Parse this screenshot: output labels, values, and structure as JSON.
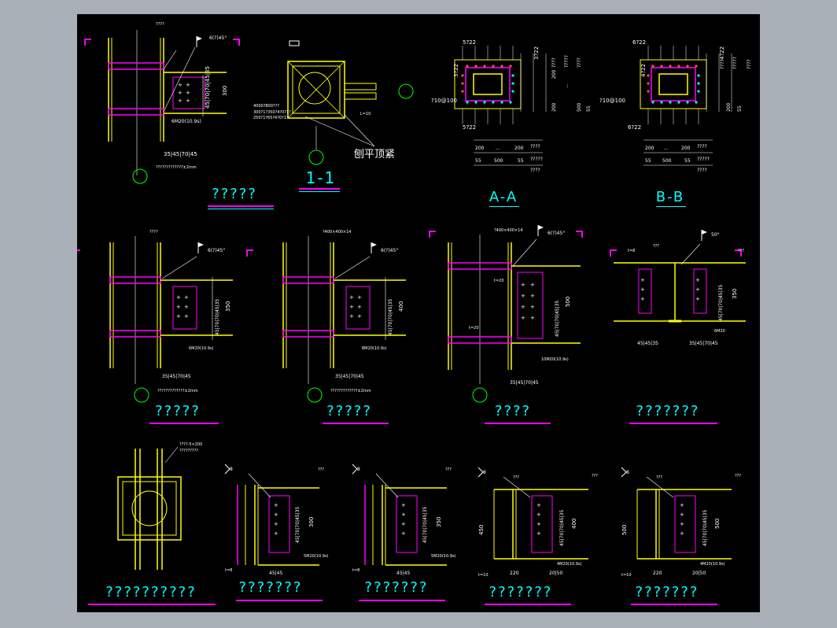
{
  "colors": {
    "background": "#000000",
    "frame": "#a9afb6",
    "column": "#ffff00",
    "plate": "#ff00ff",
    "text": "#ffffff",
    "title": "#00ffff",
    "axis": "#00ff00"
  },
  "titles": {
    "t1": "?????",
    "t2": "1-1",
    "t3": "A-A",
    "t4": "B-B",
    "t5": "?????",
    "t6": "?????",
    "t7": "????",
    "t8": "???????",
    "t9": "??????????",
    "t10": "???????",
    "t11": "???????",
    "t12": "???????",
    "t13": "???????"
  },
  "labels": {
    "planed": "刨平顶紧",
    "l10": "L=10",
    "top_q4": "????",
    "weld_a1": "6(?)45°",
    "bolts_a1": "6M20(10.9s)",
    "dims_a1": "45|70|70|45|35",
    "height_300": "300",
    "dims_bottom_a": "35|45|70|45",
    "note_a": "?????????????±2mm",
    "s11_text1": "4000?800???",
    "s11_text2": "300?1?350?4?0?1?",
    "s11_text3": "250?1?65?4?0?1?",
    "aa_top": "5?22",
    "aa_bottom": "5?22",
    "aa_left": "3?22",
    "aa_right": "3?22",
    "aa_rebar": "?10@100",
    "bb_top": "6?22",
    "bb_bottom": "6?22",
    "bb_left": "4?22",
    "bb_right": "4?22",
    "bb_rebar": "?10@100",
    "dim_200": "200",
    "dim_500": "500",
    "dim_55": "55",
    "dim_q4": "????",
    "dim_q5": "?????",
    "dim_dots": "...",
    "height_350": "350",
    "height_400": "400",
    "height_500": "500",
    "height_450": "450",
    "bolts_b2": "8M20(10.9s)",
    "bolts_b3": "10M20(10.9s)",
    "bolts_b4": "6M20",
    "bolts_c": "5M20(10.9s)",
    "bolts_c5": "4M20(10.9s)",
    "top_b2": "?400×400×14",
    "top_b3": "?400×400×14",
    "t20": "t=20",
    "t8": "t=8",
    "t10": "t=10",
    "w50": "50°",
    "q3": "???",
    "c1_note1": "????-5×200",
    "c1_note2": "?????????",
    "dims_c": "45|45",
    "dims_220": "220",
    "dims_c5": "20|50",
    "bb_dim": "45|45|35",
    "section_s1": "1",
    "s_8": "8"
  }
}
